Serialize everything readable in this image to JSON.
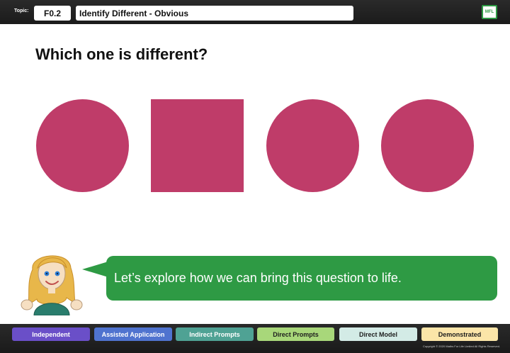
{
  "header": {
    "topic_label": "Topic:",
    "topic_code": "F0.2",
    "topic_title": "Identify Different - Obvious",
    "logo_text": "MFL"
  },
  "question": {
    "text": "Which one is different?"
  },
  "shapes": [
    {
      "kind": "circle",
      "color": "#bf3c69"
    },
    {
      "kind": "square",
      "color": "#bf3c69"
    },
    {
      "kind": "circle",
      "color": "#bf3c69"
    },
    {
      "kind": "circle",
      "color": "#bf3c69"
    }
  ],
  "speech": {
    "text": "Let’s explore how we can bring this question to life.",
    "color": "#2e9a44"
  },
  "levels": [
    {
      "label": "Independent",
      "bg": "#6a4fc8",
      "fg": "#ffffff"
    },
    {
      "label": "Assisted Application",
      "bg": "#4f73cf",
      "fg": "#ffffff"
    },
    {
      "label": "Indirect Prompts",
      "bg": "#4fa294",
      "fg": "#ffffff"
    },
    {
      "label": "Direct Prompts",
      "bg": "#a8d77a",
      "fg": "#1d1d1d"
    },
    {
      "label": "Direct Model",
      "bg": "#d3ebe6",
      "fg": "#1d1d1d"
    },
    {
      "label": "Demonstrated",
      "bg": "#fbe5a8",
      "fg": "#1d1d1d"
    }
  ],
  "footer": {
    "copyright": "Copyright © 2020 Maths For Life Limited All Rights Reserved."
  }
}
